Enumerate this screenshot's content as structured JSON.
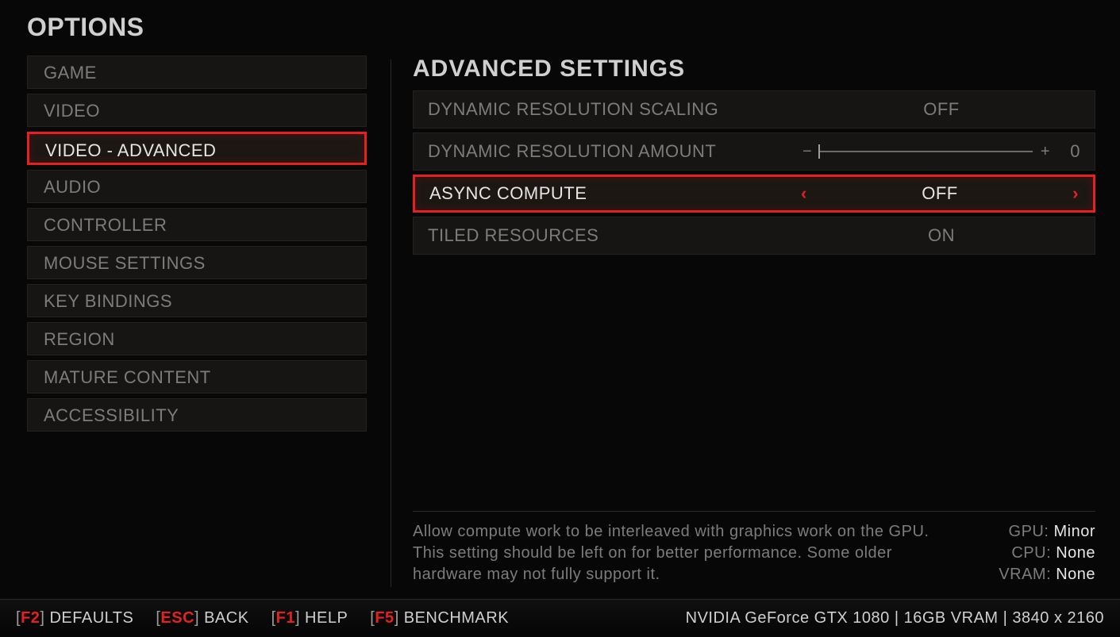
{
  "title": "OPTIONS",
  "sidebar": {
    "items": [
      {
        "label": "GAME"
      },
      {
        "label": "VIDEO"
      },
      {
        "label": "VIDEO - ADVANCED",
        "selected": true
      },
      {
        "label": "AUDIO"
      },
      {
        "label": "CONTROLLER"
      },
      {
        "label": "MOUSE SETTINGS"
      },
      {
        "label": "KEY BINDINGS"
      },
      {
        "label": "REGION"
      },
      {
        "label": "MATURE CONTENT"
      },
      {
        "label": "ACCESSIBILITY"
      }
    ]
  },
  "panel": {
    "title": "ADVANCED SETTINGS",
    "rows": [
      {
        "label": "DYNAMIC RESOLUTION SCALING",
        "value": "OFF",
        "kind": "toggle"
      },
      {
        "label": "DYNAMIC RESOLUTION AMOUNT",
        "value": "0",
        "kind": "slider"
      },
      {
        "label": "ASYNC COMPUTE",
        "value": "OFF",
        "kind": "toggle",
        "selected": true
      },
      {
        "label": "TILED RESOURCES",
        "value": "ON",
        "kind": "toggle"
      }
    ]
  },
  "help": {
    "line1": "Allow compute work to be interleaved with graphics work on the GPU.",
    "line2": "This setting should be left on for better performance. Some older hardware may not fully support it."
  },
  "impact": {
    "gpu_label": "GPU: ",
    "gpu": "Minor",
    "cpu_label": "CPU: ",
    "cpu": "None",
    "vram_label": "VRAM: ",
    "vram": "None"
  },
  "footer": {
    "hotkeys": [
      {
        "key": "F2",
        "label": "DEFAULTS"
      },
      {
        "key": "ESC",
        "label": "BACK"
      },
      {
        "key": "F1",
        "label": "HELP"
      },
      {
        "key": "F5",
        "label": "BENCHMARK"
      }
    ],
    "hw": "NVIDIA GeForce GTX 1080 | 16GB VRAM | 3840 x 2160"
  },
  "glyphs": {
    "left": "‹",
    "right": "›",
    "minus": "−",
    "plus": "+"
  }
}
